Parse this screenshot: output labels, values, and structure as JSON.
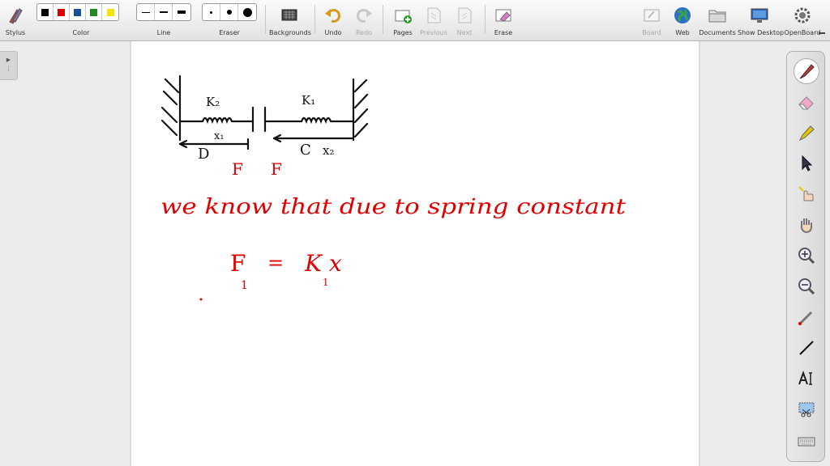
{
  "toolbar": {
    "stylus": {
      "label": "Stylus"
    },
    "color": {
      "label": "Color",
      "swatches": [
        "#000000",
        "#e00000",
        "#1a4f9c",
        "#1f8a1f",
        "#f2e600"
      ]
    },
    "line": {
      "label": "Line"
    },
    "eraser": {
      "label": "Eraser"
    },
    "backgrounds": {
      "label": "Backgrounds"
    },
    "undo": {
      "label": "Undo"
    },
    "redo": {
      "label": "Redo"
    },
    "pages": {
      "label": "Pages"
    },
    "previous": {
      "label": "Previous"
    },
    "next": {
      "label": "Next"
    },
    "erase": {
      "label": "Erase"
    },
    "board": {
      "label": "Board"
    },
    "web": {
      "label": "Web"
    },
    "documents": {
      "label": "Documents"
    },
    "show_desktop": {
      "label": "Show Desktop"
    },
    "openboard": {
      "label": "OpenBoard"
    }
  },
  "drawing": {
    "ink_colors": {
      "black": "#111111",
      "red": "#e00000"
    },
    "labels": {
      "k2": "K₂",
      "k1": "K₁",
      "x1": "x₁",
      "x2": "x₂",
      "d": "D",
      "c": "C",
      "f_left": "F",
      "f_right": "F"
    },
    "sentence": "we know that due to spring constant",
    "equation": {
      "lhs": "F",
      "lhs_sub": "1",
      "eq": "=",
      "rhs": "K x",
      "rhs_sub": "1"
    }
  },
  "dock": {
    "tools": [
      "pen-icon",
      "eraser-icon",
      "highlighter-icon",
      "pointer-icon",
      "interact-icon",
      "hand-icon",
      "zoom-in-icon",
      "zoom-out-icon",
      "laser-icon",
      "line-icon",
      "text-icon",
      "capture-icon",
      "keyboard-icon"
    ]
  }
}
